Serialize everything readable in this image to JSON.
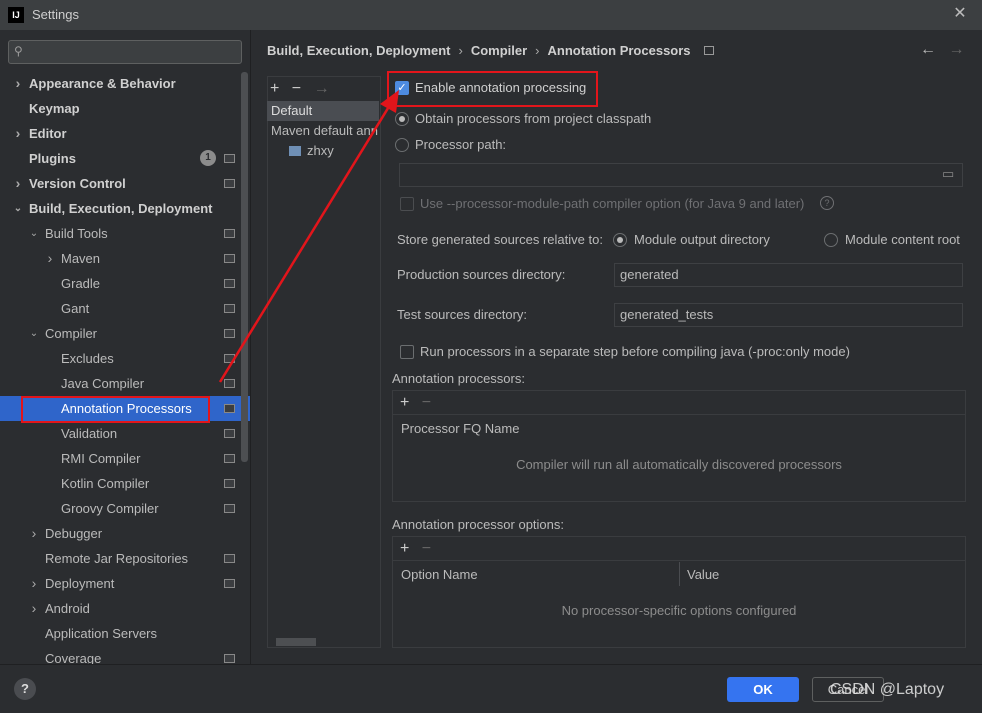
{
  "window": {
    "title": "Settings",
    "logo": "IJ"
  },
  "search": {
    "placeholder": ""
  },
  "sidebar": {
    "items": [
      {
        "label": "Appearance & Behavior",
        "bold": true,
        "chevron": "right",
        "level": 0
      },
      {
        "label": "Keymap",
        "bold": true,
        "chevron": "",
        "level": 0
      },
      {
        "label": "Editor",
        "bold": true,
        "chevron": "right",
        "level": 0
      },
      {
        "label": "Plugins",
        "bold": true,
        "chevron": "",
        "level": 0,
        "badge": "1",
        "gear": true
      },
      {
        "label": "Version Control",
        "bold": true,
        "chevron": "right",
        "level": 0,
        "gear": true
      },
      {
        "label": "Build, Execution, Deployment",
        "bold": true,
        "chevron": "down",
        "level": 0
      },
      {
        "label": "Build Tools",
        "bold": false,
        "chevron": "down",
        "level": 1,
        "gear": true
      },
      {
        "label": "Maven",
        "bold": false,
        "chevron": "right",
        "level": 2,
        "gear": true
      },
      {
        "label": "Gradle",
        "bold": false,
        "chevron": "",
        "level": 2,
        "gear": true
      },
      {
        "label": "Gant",
        "bold": false,
        "chevron": "",
        "level": 2,
        "gear": true
      },
      {
        "label": "Compiler",
        "bold": false,
        "chevron": "down",
        "level": 1,
        "gear": true
      },
      {
        "label": "Excludes",
        "bold": false,
        "chevron": "",
        "level": 2,
        "gear": true
      },
      {
        "label": "Java Compiler",
        "bold": false,
        "chevron": "",
        "level": 2,
        "gear": true
      },
      {
        "label": "Annotation Processors",
        "bold": false,
        "chevron": "",
        "level": 2,
        "gear": true,
        "selected": true
      },
      {
        "label": "Validation",
        "bold": false,
        "chevron": "",
        "level": 2,
        "gear": true
      },
      {
        "label": "RMI Compiler",
        "bold": false,
        "chevron": "",
        "level": 2,
        "gear": true
      },
      {
        "label": "Kotlin Compiler",
        "bold": false,
        "chevron": "",
        "level": 2,
        "gear": true
      },
      {
        "label": "Groovy Compiler",
        "bold": false,
        "chevron": "",
        "level": 2,
        "gear": true
      },
      {
        "label": "Debugger",
        "bold": false,
        "chevron": "right",
        "level": 1
      },
      {
        "label": "Remote Jar Repositories",
        "bold": false,
        "chevron": "",
        "level": 1,
        "gear": true
      },
      {
        "label": "Deployment",
        "bold": false,
        "chevron": "right",
        "level": 1,
        "gear": true
      },
      {
        "label": "Android",
        "bold": false,
        "chevron": "right",
        "level": 1
      },
      {
        "label": "Application Servers",
        "bold": false,
        "chevron": "",
        "level": 1
      },
      {
        "label": "Coverage",
        "bold": false,
        "chevron": "",
        "level": 1,
        "gear": true
      }
    ]
  },
  "breadcrumb": {
    "parts": [
      "Build, Execution, Deployment",
      "Compiler",
      "Annotation Processors"
    ]
  },
  "profiles": {
    "toolbar": {
      "add": "+",
      "remove": "−",
      "move": "→"
    },
    "items": [
      "Default",
      "Maven default ann",
      "zhxy"
    ]
  },
  "settings": {
    "enable_label": "Enable annotation processing",
    "obtain_label": "Obtain processors from project classpath",
    "processor_path_label": "Processor path:",
    "processor_path_value": "",
    "module_path_label": "Use --processor-module-path compiler option (for Java 9 and later)",
    "store_label": "Store generated sources relative to:",
    "module_output_label": "Module output directory",
    "module_content_label": "Module content root",
    "production_label": "Production sources directory:",
    "production_value": "generated",
    "test_label": "Test sources directory:",
    "test_value": "generated_tests",
    "separate_step_label": "Run processors in a separate step before compiling java (-proc:only mode)"
  },
  "processors_panel": {
    "title": "Annotation processors:",
    "column": "Processor FQ Name",
    "empty_text": "Compiler will run all automatically discovered processors"
  },
  "options_panel": {
    "title": "Annotation processor options:",
    "columns": [
      "Option Name",
      "Value"
    ],
    "empty_text": "No processor-specific options configured"
  },
  "footer": {
    "help": "?",
    "ok": "OK",
    "cancel": "Cancel",
    "watermark": "CSDN @Laptoy"
  },
  "colors": {
    "accent": "#3574f0",
    "selection": "#2f65ca",
    "highlight": "#e2151b"
  }
}
